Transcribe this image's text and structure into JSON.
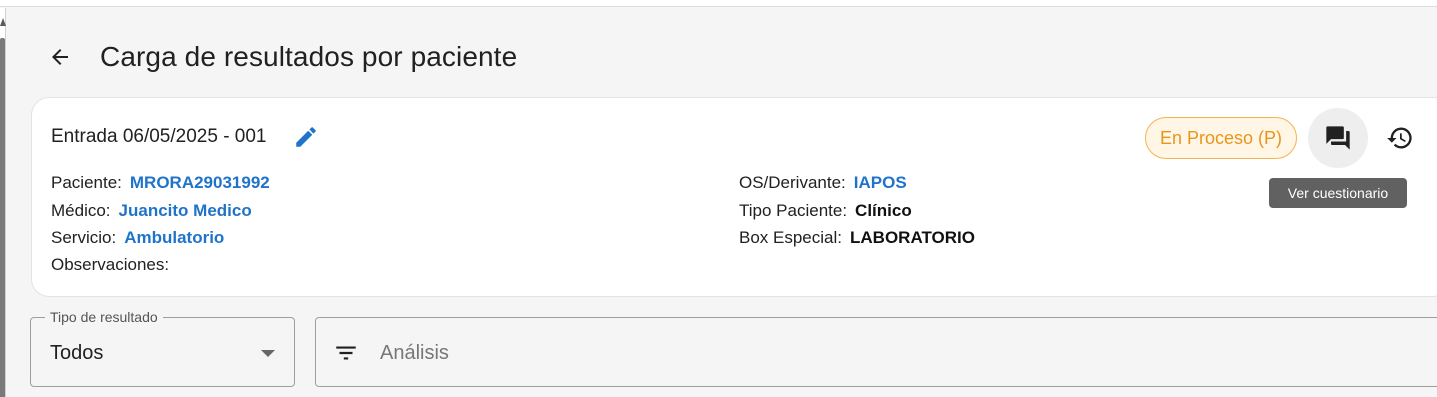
{
  "page": {
    "title": "Carga de resultados por paciente"
  },
  "entry": {
    "title": "Entrada 06/05/2025 - 001"
  },
  "fields_left": [
    {
      "label": "Paciente:",
      "value": "MRORA29031992"
    },
    {
      "label": "Médico:",
      "value": "Juancito Medico"
    },
    {
      "label": "Servicio:",
      "value": "Ambulatorio"
    },
    {
      "label": "Observaciones:",
      "value": ""
    }
  ],
  "fields_right": [
    {
      "label": "OS/Derivante:",
      "value": "IAPOS"
    },
    {
      "label": "Tipo Paciente:",
      "value": "Clínico"
    },
    {
      "label": "Box Especial:",
      "value": "LABORATORIO"
    }
  ],
  "status": {
    "label": "En Proceso (P)",
    "color": "#e8951c"
  },
  "tooltip": {
    "text": "Ver cuestionario"
  },
  "filters": {
    "tipo_label": "Tipo de resultado",
    "tipo_value": "Todos",
    "search_placeholder": "Análisis"
  },
  "colors": {
    "link": "#1f74c9",
    "accent": "#1f74c9",
    "status_border": "#f3b351"
  },
  "icons": [
    "arrow-left-icon",
    "pencil-icon",
    "forum-icon",
    "history-icon",
    "filter-icon",
    "chevron-down-icon"
  ]
}
